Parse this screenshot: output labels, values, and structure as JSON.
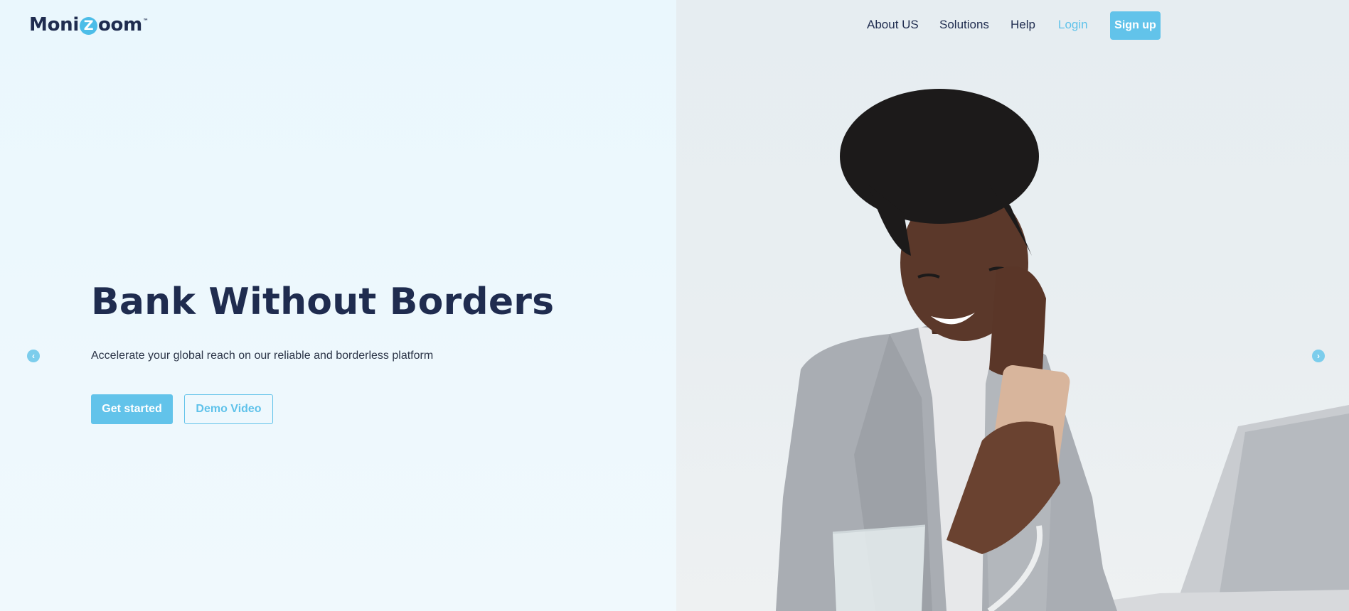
{
  "brand": {
    "logo_pre": "Moni",
    "logo_z": "Z",
    "logo_post": "oom",
    "logo_tm": "™",
    "accent_color": "#62c3ea",
    "dark_color": "#1f2c4f"
  },
  "nav": {
    "about": "About US",
    "solutions": "Solutions",
    "help": "Help",
    "login": "Login",
    "signup": "Sign up"
  },
  "hero": {
    "title": "Bank Without Borders",
    "subtitle": "Accelerate your global reach on our reliable and borderless platform",
    "primary_cta": "Get started",
    "secondary_cta": "Demo Video"
  },
  "carousel": {
    "prev_icon": "chevron-left-icon",
    "next_icon": "chevron-right-icon"
  }
}
